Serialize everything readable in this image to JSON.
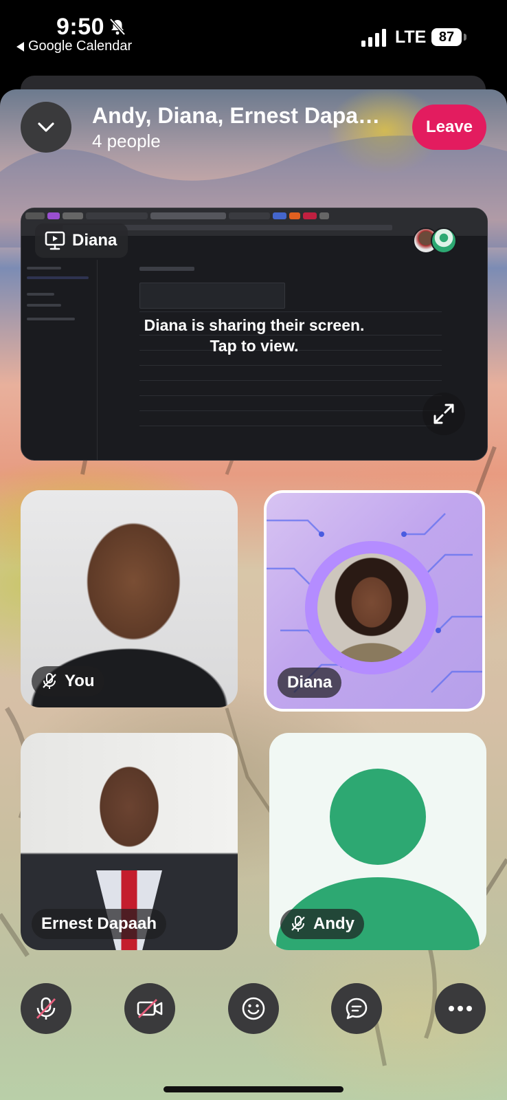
{
  "status_bar": {
    "time": "9:50",
    "back_app": "Google Calendar",
    "network": "LTE",
    "battery": "87"
  },
  "header": {
    "title": "Andy, Diana, Ernest Dapaah,...",
    "subtitle": "4 people",
    "leave_label": "Leave"
  },
  "screen_share": {
    "presenter": "Diana",
    "message_line1": "Diana is sharing their screen.",
    "message_line2": "Tap to view."
  },
  "participants": [
    {
      "name": "You",
      "muted": true
    },
    {
      "name": "Diana",
      "muted": false,
      "active_speaker": true
    },
    {
      "name": "Ernest Dapaah",
      "muted": false
    },
    {
      "name": "Andy",
      "muted": true
    }
  ],
  "controls": [
    "mic-muted-icon",
    "camera-off-icon",
    "emoji-icon",
    "chat-icon",
    "more-icon"
  ],
  "colors": {
    "leave": "#e31c5f",
    "andy_avatar": "#2da872",
    "diana_ring": "#b48cff"
  }
}
